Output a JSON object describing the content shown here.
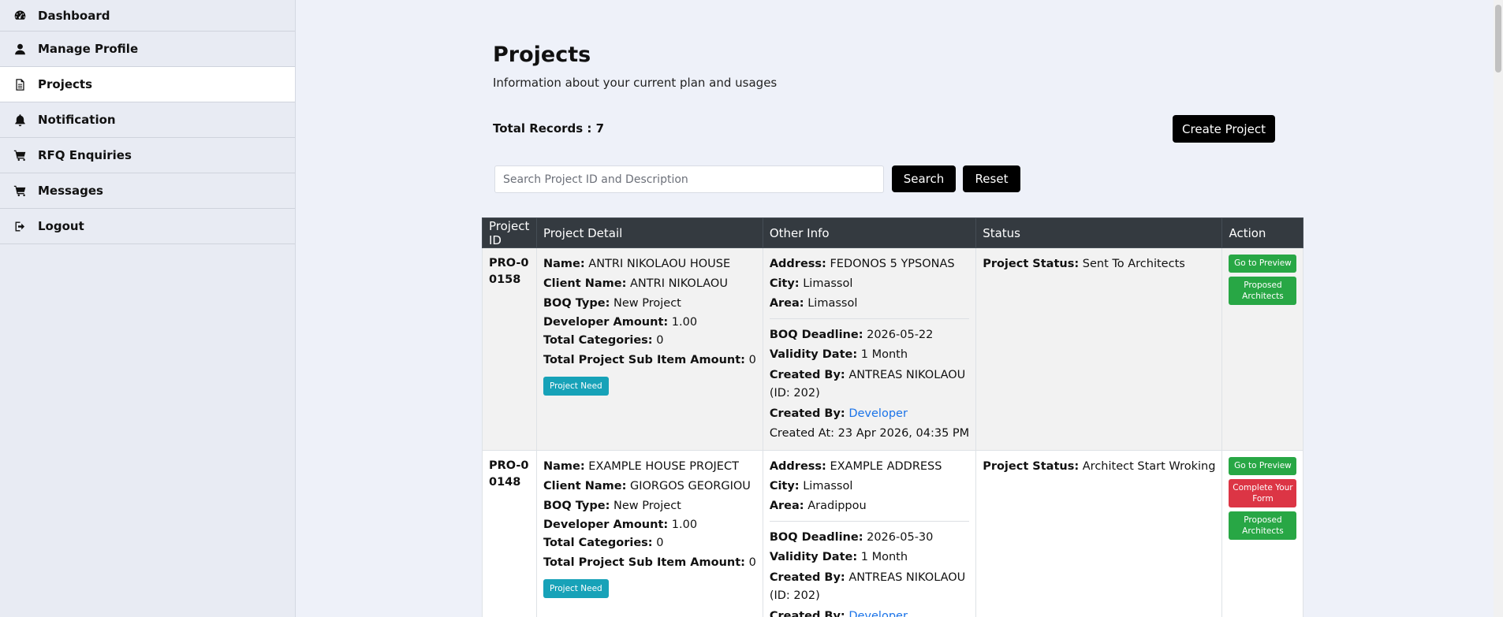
{
  "sidebar": {
    "items": [
      {
        "label": "Dashboard",
        "icon": "dashboard-icon",
        "active": false
      },
      {
        "label": "Manage Profile",
        "icon": "user-icon",
        "active": false
      },
      {
        "label": "Projects",
        "icon": "document-icon",
        "active": true
      },
      {
        "label": "Notification",
        "icon": "bell-icon",
        "active": false
      },
      {
        "label": "RFQ Enquiries",
        "icon": "cart-icon",
        "active": false
      },
      {
        "label": "Messages",
        "icon": "cart-icon",
        "active": false
      },
      {
        "label": "Logout",
        "icon": "logout-icon",
        "active": false
      }
    ]
  },
  "page": {
    "title": "Projects",
    "subtitle": "Information about your current plan and usages",
    "total_records": "Total Records : 7",
    "create_label": "Create Project"
  },
  "search": {
    "placeholder": "Search Project ID and Description",
    "value": "",
    "search_label": "Search",
    "reset_label": "Reset"
  },
  "table": {
    "headers": [
      "Project ID",
      "Project Detail",
      "Other Info",
      "Status",
      "Action"
    ],
    "labels": {
      "name": "Name:",
      "client": "Client Name:",
      "boq_type": "BOQ Type:",
      "dev_amount": "Developer Amount:",
      "total_categories": "Total Categories:",
      "total_sub": "Total Project Sub Item Amount:",
      "address": "Address:",
      "city": "City:",
      "area": "Area:",
      "boq_deadline": "BOQ Deadline:",
      "validity": "Validity Date:",
      "created_by": "Created By:",
      "project_status": "Project Status:"
    },
    "rows": [
      {
        "id": "PRO-00158",
        "name": "ANTRI NIKOLAOU HOUSE",
        "client": "ANTRI NIKOLAOU",
        "boq_type": "New Project",
        "dev_amount": "1.00",
        "total_categories": "0",
        "total_sub": "0",
        "need_label": "Project Need",
        "address": "FEDONOS 5 YPSONAS",
        "city": "Limassol",
        "area": "Limassol",
        "boq_deadline": "2026-05-22",
        "validity": "1 Month",
        "created_by": "ANTREAS NIKOLAOU (ID: 202)",
        "created_by_role": "Developer",
        "created_at": "Created At: 23 Apr 2026, 04:35 PM",
        "status": "Sent To Architects",
        "actions": [
          "Go to Preview",
          "Proposed Architects"
        ]
      },
      {
        "id": "PRO-00148",
        "name": "EXAMPLE HOUSE PROJECT",
        "client": "GIORGOS GEORGIOU",
        "boq_type": "New Project",
        "dev_amount": "1.00",
        "total_categories": "0",
        "total_sub": "0",
        "need_label": "Project Need",
        "address": "EXAMPLE ADDRESS",
        "city": "Limassol",
        "area": "Aradippou",
        "boq_deadline": "2026-05-30",
        "validity": "1 Month",
        "created_by": "ANTREAS NIKOLAOU (ID: 202)",
        "created_by_role": "Developer",
        "status": "Architect Start Wroking",
        "actions": [
          "Go to Preview",
          "Complete Your Form",
          "Proposed Architects"
        ]
      }
    ]
  },
  "colors": {
    "sidebar_bg": "#e8ebf3",
    "page_bg": "#eef1f9",
    "table_header": "#343a40",
    "green": "#28a745",
    "red": "#dc3545",
    "info": "#17a2b8",
    "link": "#1a73e8"
  }
}
